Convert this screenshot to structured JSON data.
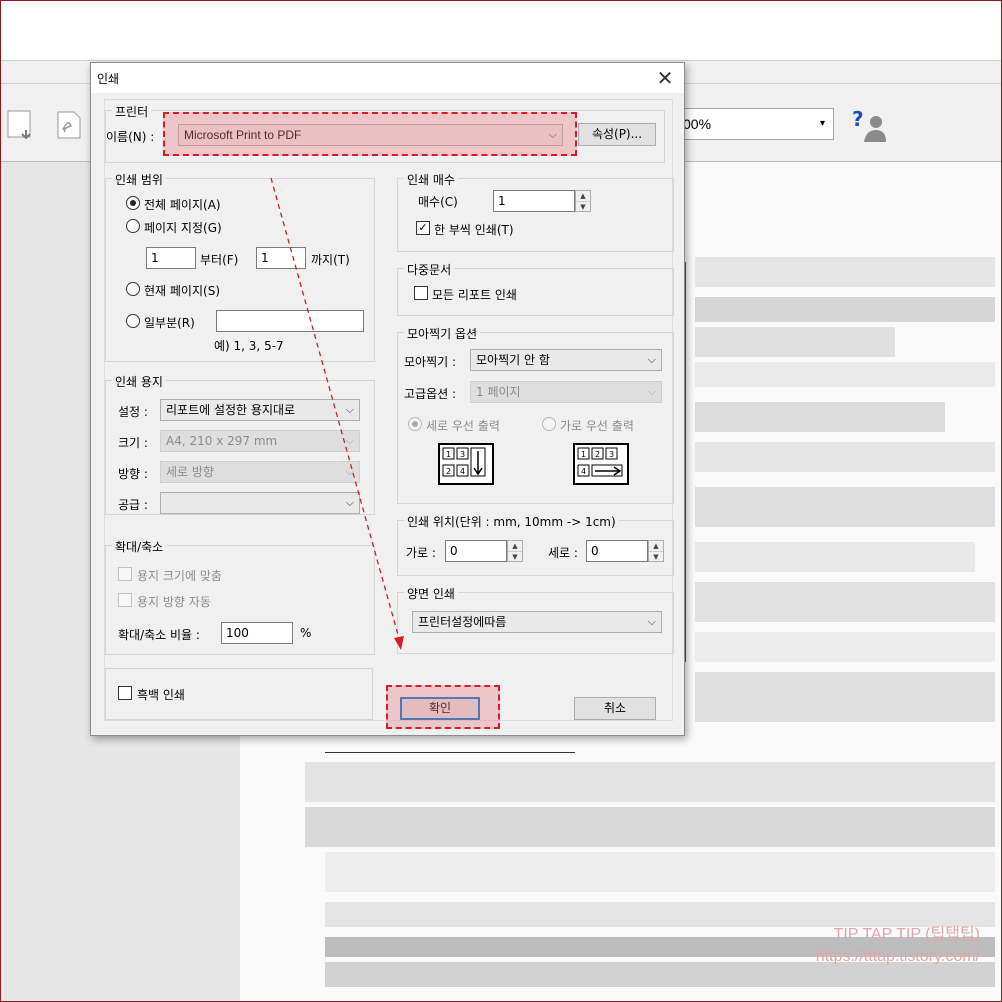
{
  "app": {
    "zoom_value": "00%",
    "zoom_arrow": "▾"
  },
  "dialog": {
    "title": "인쇄",
    "printer": {
      "legend": "프린터",
      "name_label": "이름(N) :",
      "name_value": "Microsoft Print to PDF",
      "properties_button": "속성(P)..."
    },
    "range": {
      "legend": "인쇄 범위",
      "all_pages": "전체 페이지(A)",
      "page_select": "페이지 지정(G)",
      "from_value": "1",
      "from_label": "부터(F)",
      "to_value": "1",
      "to_label": "까지(T)",
      "current_page": "현재 페이지(S)",
      "partial": "일부분(R)",
      "partial_value": "",
      "example": "예) 1, 3, 5-7"
    },
    "paper": {
      "legend": "인쇄 용지",
      "setting_label": "설정 :",
      "setting_value": "리포트에 설정한 용지대로",
      "size_label": "크기 :",
      "size_value": "A4, 210 x 297 mm",
      "orientation_label": "방향 :",
      "orientation_value": "세로 방향",
      "source_label": "공급 :",
      "source_value": ""
    },
    "scale": {
      "legend": "확대/축소",
      "fit_paper": "용지 크기에 맞춤",
      "auto_orientation": "용지 방향 자동",
      "ratio_label": "확대/축소 비율 :",
      "ratio_value": "100",
      "ratio_unit": "%"
    },
    "mono": "흑백 인쇄",
    "copies": {
      "legend": "인쇄 매수",
      "count_label": "매수(C)",
      "count_value": "1",
      "collate": "한 부씩 인쇄(T)"
    },
    "multi_doc": {
      "legend": "다중문서",
      "all_reports": "모든 리포트 인쇄"
    },
    "nup": {
      "legend": "모아찍기 옵션",
      "label": "모아찍기 :",
      "value": "모아찍기 안 함",
      "advanced_label": "고급옵션 :",
      "advanced_value": "1 페이지",
      "vertical_first": "세로 우선 출력",
      "horizontal_first": "가로 우선 출력",
      "icon_digits": [
        "1",
        "2",
        "3",
        "4"
      ]
    },
    "position": {
      "legend": "인쇄 위치(단위 : mm, 10mm -> 1cm)",
      "h_label": "가로 :",
      "h_value": "0",
      "v_label": "세로 :",
      "v_value": "0"
    },
    "duplex": {
      "legend": "양면 인쇄",
      "value": "프린터설정에따름"
    },
    "ok_button": "확인",
    "cancel_button": "취소"
  },
  "watermark": {
    "line1": "TIP TAP TIP (팁탭팁)",
    "line2": "https://tttap.tistory.com/"
  },
  "colors": {
    "highlight_border": "#d21e2b",
    "highlight_fill": "#e87882",
    "default_button_border": "#0078d7",
    "frame": "#8b1a22"
  }
}
